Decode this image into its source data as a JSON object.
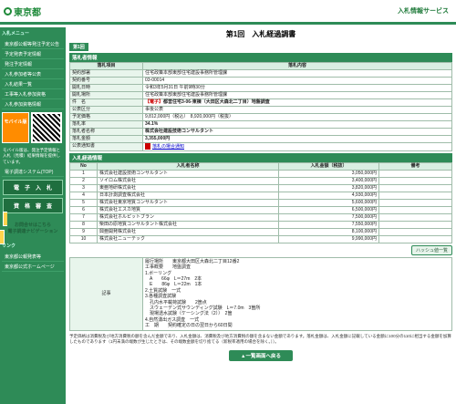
{
  "header": {
    "logo": "東京都",
    "service": "入札情報サービス"
  },
  "sidebar": {
    "menu_title": "入札メニュー",
    "items": [
      "東京都公報等発注予定公告",
      "予定発表予定情報",
      "発注予定情報",
      "入札参加者等公表",
      "入札結果一覧",
      "工事等入札参加資格",
      "入札参加資格情報"
    ],
    "mobile_label": "モバイル版",
    "mobile_note": "モバイル版は、発注予定情報と入札（見積）結果情報を提供しています。",
    "bid_system": "電子調達システム(TOP)",
    "btn_denshi": "電　子　入　札",
    "btn_shikaku": "資　格　審　査",
    "contact": "お問合せはこちら",
    "contact_sub": "電子調達ナビゲーション",
    "links_title": "リンク",
    "links": [
      "東京都公報発表等",
      "東京都公式ホームページ"
    ]
  },
  "page": {
    "title": "第1回　入札経過調書",
    "tab": "第1回",
    "section1": "落札者情報",
    "col_item": "落札項目",
    "col_content": "落札内容",
    "rows": [
      {
        "label": "契約部署",
        "value": "住宅政策本部東部住宅建設事務所管理課"
      },
      {
        "label": "契約番号",
        "value": "03-00014"
      },
      {
        "label": "開札日時",
        "value": "令和3年5月31日 午前9時30分"
      },
      {
        "label": "開札場所",
        "value": "住宅政策本部東部住宅建設事務所管理課"
      },
      {
        "label": "件　名",
        "value": "都営住宅3-06-東棟（大田区大森北二丁目）地盤調査",
        "tag": "【電子】"
      },
      {
        "label": "公表区分",
        "value": "事後公表"
      },
      {
        "label": "予定価格",
        "value": "9,812,000円（税込）　8,920,000円（税抜）"
      },
      {
        "label": "落札率",
        "value": "34.1%"
      },
      {
        "label": "落札者名称",
        "value": "株式会社建設技術コンサルタント"
      },
      {
        "label": "落札金額",
        "value": "3,355,000円"
      },
      {
        "label": "公表通知書",
        "value": "落札の場合通知"
      }
    ],
    "section2": "入札経過情報",
    "bid_headers": [
      "No",
      "入札者名称",
      "入札金額（税抜）",
      "備考"
    ],
    "bids": [
      {
        "no": "1",
        "name": "株式会社建設技術コンサルタント",
        "amount": "3,050,000円"
      },
      {
        "no": "2",
        "name": "ソイロム株式会社",
        "amount": "3,400,000円"
      },
      {
        "no": "3",
        "name": "東亜地研株式会社",
        "amount": "3,820,000円"
      },
      {
        "no": "4",
        "name": "日本計測調査株式会社",
        "amount": "4,930,000円"
      },
      {
        "no": "5",
        "name": "株式会社東京地質コンサルタント",
        "amount": "5,600,000円"
      },
      {
        "no": "6",
        "name": "株式会社エスカ地質",
        "amount": "6,500,000円"
      },
      {
        "no": "7",
        "name": "株式会社ホルピットブラン",
        "amount": "7,500,000円"
      },
      {
        "no": "8",
        "name": "柴田の原地質コンサルタント株式会社",
        "amount": "7,550,000円"
      },
      {
        "no": "9",
        "name": "興亜開発株式会社",
        "amount": "8,100,000円"
      },
      {
        "no": "10",
        "name": "株式会社ニューテック",
        "amount": "9,990,000円"
      }
    ],
    "history_btn": "ハッシュ値一覧",
    "notes_label": "記事",
    "notes": "履行場所　　東京都大田区大森北二丁目12番2\n工事概要　　地盤調査\n1.ボーリング\n　A　　66φ　L＝27m　2本\n　E　　86φ　L＝22m　1本\n2.土質試験　一式\n3.各種調査試験\n　孔内水平載荷試験　　2箇点\n　スウェーデン式サウンディング試験　L＝7.0m　3箇所\n　現場透水試験（ケーシング法（2））　2箇\n4.自然湧出ガス調査　一式\n工　期　　契約確定の日の翌日から60日間",
    "footer": "予定価格は消費税及び地方消費税の額を含んだ金額であり、入札金額は、消費税及び地方消費税の額を含まない金額であります。落札金額は、入札金額に記載している金額に100分の110に相当する金額を加算したものであります（1円未満の端数が生じたときは、その端数金額を切り捨てる（新税率適用の場合を除く。））。",
    "back": "▲一覧画面へ戻る"
  }
}
